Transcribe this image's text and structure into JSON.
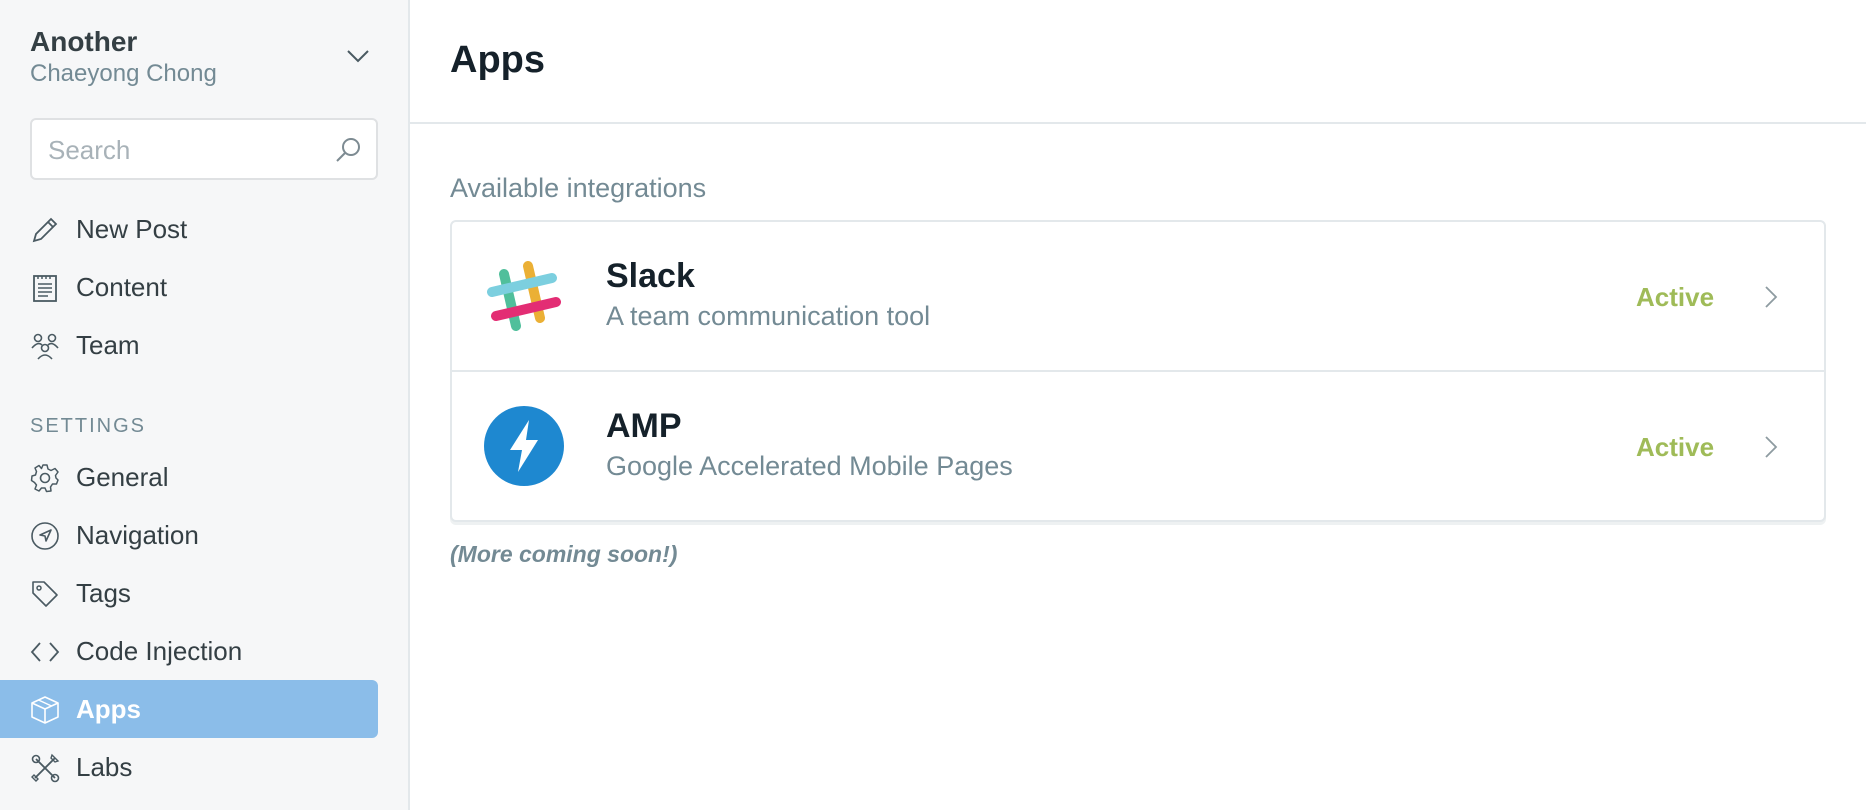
{
  "sidebar": {
    "blog_title": "Another",
    "blog_user": "Chaeyong Chong",
    "search": {
      "placeholder": "Search",
      "value": ""
    },
    "primary_items": [
      {
        "label": "New Post",
        "icon": "pencil-icon"
      },
      {
        "label": "Content",
        "icon": "document-icon"
      },
      {
        "label": "Team",
        "icon": "team-icon"
      }
    ],
    "settings_heading": "SETTINGS",
    "settings_items": [
      {
        "label": "General",
        "icon": "gear-icon"
      },
      {
        "label": "Navigation",
        "icon": "compass-icon"
      },
      {
        "label": "Tags",
        "icon": "tag-icon"
      },
      {
        "label": "Code Injection",
        "icon": "code-icon"
      },
      {
        "label": "Apps",
        "icon": "box-icon",
        "active": true
      },
      {
        "label": "Labs",
        "icon": "tools-icon"
      }
    ]
  },
  "main": {
    "title": "Apps",
    "section_label": "Available integrations",
    "apps": [
      {
        "name": "Slack",
        "description": "A team communication tool",
        "status": "Active",
        "icon": "slack-logo-icon"
      },
      {
        "name": "AMP",
        "description": "Google Accelerated Mobile Pages",
        "status": "Active",
        "icon": "amp-logo-icon"
      }
    ],
    "footnote": "(More coming soon!)"
  },
  "colors": {
    "sidebar_bg": "#f6f7f8",
    "active_item_bg": "#8bbde9",
    "status_active": "#9fbb58",
    "muted_text": "#738a94",
    "amp_blue": "#1e88d0"
  }
}
